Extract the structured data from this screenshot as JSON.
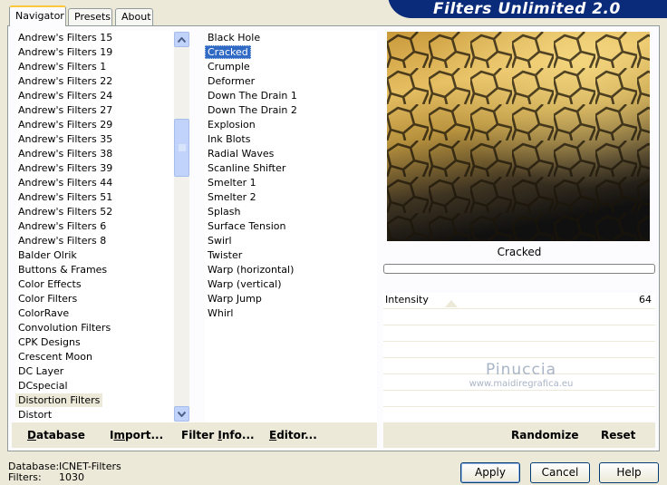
{
  "title": "Filters Unlimited 2.0",
  "tabs": [
    "Navigator",
    "Presets",
    "About"
  ],
  "categories": [
    "Andrew's Filters 15",
    "Andrew's Filters 19",
    "Andrew's Filters 1",
    "Andrew's Filters 22",
    "Andrew's Filters 24",
    "Andrew's Filters 27",
    "Andrew's Filters 29",
    "Andrew's Filters 35",
    "Andrew's Filters 38",
    "Andrew's Filters 39",
    "Andrew's Filters 44",
    "Andrew's Filters 51",
    "Andrew's Filters 52",
    "Andrew's Filters 6",
    "Andrew's Filters 8",
    "Balder Olrik",
    "Buttons & Frames",
    "Color Effects",
    "Color Filters",
    "ColorRave",
    "Convolution Filters",
    "CPK Designs",
    "Crescent Moon",
    "DC Layer",
    "DCspecial",
    "Distortion Filters",
    "Distort"
  ],
  "selected_category": "Distortion Filters",
  "filters": [
    "Black Hole",
    "Cracked",
    "Crumple",
    "Deformer",
    "Down The Drain 1",
    "Down The Drain 2",
    "Explosion",
    "Ink Blots",
    "Radial Waves",
    "Scanline Shifter",
    "Smelter 1",
    "Smelter 2",
    "Splash",
    "Surface Tension",
    "Swirl",
    "Twister",
    "Warp (horizontal)",
    "Warp (vertical)",
    "Warp Jump",
    "Whirl"
  ],
  "selected_filter": "Cracked",
  "toolbar": {
    "database": {
      "u": "D",
      "rest": "atabase"
    },
    "import": {
      "pre": "I",
      "u": "m",
      "rest": "port..."
    },
    "filter_info": {
      "pre": "Filter ",
      "u": "I",
      "rest": "nfo..."
    },
    "editor": {
      "u": "E",
      "rest": "ditor..."
    },
    "randomize": "Randomize",
    "reset": "Reset"
  },
  "preview": {
    "caption": "Cracked"
  },
  "parameter": {
    "label": "Intensity",
    "value": "64"
  },
  "watermark": {
    "name": "Pinuccia",
    "url": "www.maidiregrafica.eu"
  },
  "status": {
    "database_label": "Database:",
    "database_value": "ICNET-Filters",
    "filters_label": "Filters:",
    "filters_value": "1030"
  },
  "buttons": {
    "apply": "Apply",
    "cancel": "Cancel",
    "help": "Help"
  },
  "colors": {
    "selection": "#316ac5",
    "banner": "#0a2a7a",
    "face": "#ece9d8"
  }
}
